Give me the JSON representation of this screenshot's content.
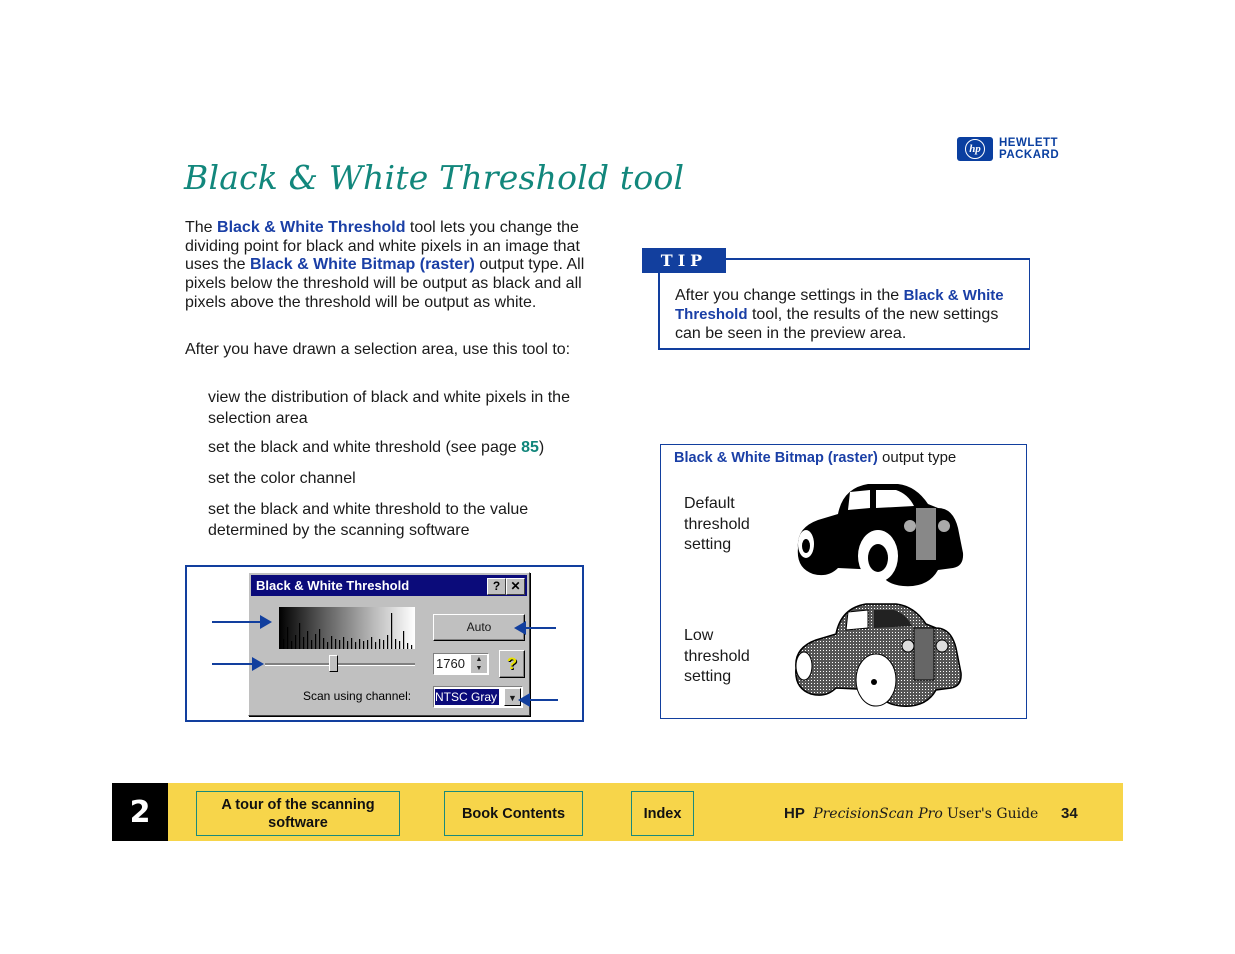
{
  "logo": {
    "mark": "hp",
    "line1": "HEWLETT",
    "line2": "PACKARD"
  },
  "title": "Black & White Threshold tool",
  "intro": {
    "t1": "The ",
    "link1": "Black & White Threshold",
    "t2": " tool lets you change the dividing point for black and white pixels in an image that uses the ",
    "link2": "Black & White Bitmap (raster)",
    "t3": " output type. All pixels below the threshold will be output as black and all pixels above the threshold will be output as white."
  },
  "lead": "After you have drawn a selection area, use this tool to:",
  "list": [
    {
      "text": "view the distribution of black and white pixels in the selection area"
    },
    {
      "text": "set the black and white threshold (see page ",
      "page": "85",
      "after": ")"
    },
    {
      "text": "set the color channel"
    },
    {
      "text": "set the black and white threshold to the value determined by the scanning software"
    }
  ],
  "tip": {
    "label": "TIP",
    "t1": "After you change settings in the ",
    "link": "Black & White Threshold",
    "t2": " tool, the results of the new settings can be seen in the preview area."
  },
  "dialog": {
    "title": "Black & White Threshold",
    "help_btn": "?",
    "close_btn": "✕",
    "auto_btn": "Auto",
    "threshold_value": "1760",
    "spin_up": "▲",
    "spin_down": "▼",
    "question_btn": "?",
    "channel_label": "Scan using channel:",
    "channel_value": "NTSC Gray",
    "combo_arrow": "▼",
    "slider_position": 0.45
  },
  "sample": {
    "heading_link": "Black & White Bitmap (raster)",
    "heading_rest": " output type",
    "default_label": "Default threshold setting",
    "low_label": "Low threshold setting"
  },
  "footer": {
    "chapter": "2",
    "nav1": "A tour of the scanning software",
    "nav2": "Book Contents",
    "nav3": "Index",
    "guide_hp": "HP",
    "guide_product": "PrecisionScan Pro",
    "guide_rest": "User's Guide",
    "page": "34"
  },
  "colors": {
    "title": "#12877c",
    "link_blue": "#1a3fa6",
    "tip_blue": "#123f9e",
    "footer_yellow": "#f7d54a",
    "nav_border": "#1a8a7c",
    "dialog_title": "#0b0b7a"
  }
}
